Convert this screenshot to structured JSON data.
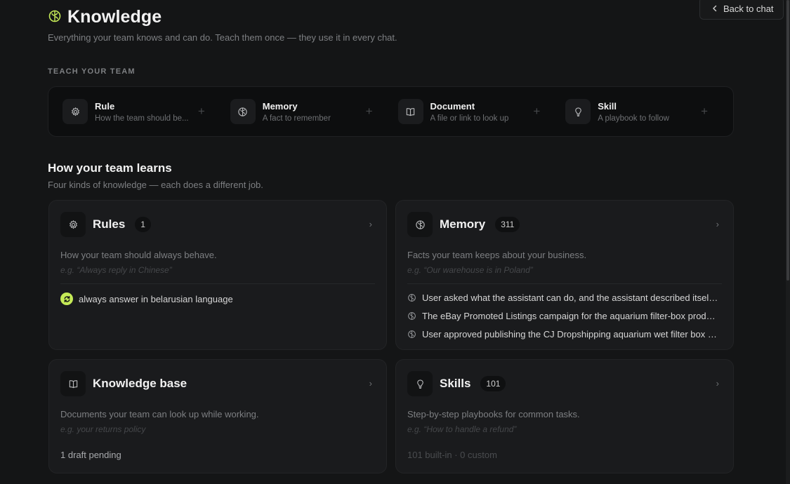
{
  "header": {
    "title": "Knowledge",
    "subtitle": "Everything your team knows and can do. Teach them once — they use it in every chat.",
    "back_label": "Back to chat"
  },
  "teach": {
    "label": "TEACH YOUR TEAM",
    "items": [
      {
        "name": "Rule",
        "desc": "How the team should be...",
        "icon": "gear-icon"
      },
      {
        "name": "Memory",
        "desc": "A fact to remember",
        "icon": "brain-icon"
      },
      {
        "name": "Document",
        "desc": "A file or link to look up",
        "icon": "book-icon"
      },
      {
        "name": "Skill",
        "desc": "A playbook to follow",
        "icon": "lightbulb-icon"
      }
    ],
    "plus": "+"
  },
  "learn": {
    "title": "How your team learns",
    "subtitle": "Four kinds of knowledge — each does a different job."
  },
  "cards": {
    "rules": {
      "title": "Rules",
      "count": "1",
      "desc": "How your team should always behave.",
      "example": "e.g. “Always reply in Chinese”",
      "item": "always answer in belarusian language"
    },
    "memory": {
      "title": "Memory",
      "count": "311",
      "desc": "Facts your team keeps about your business.",
      "example": "e.g. “Our warehouse is in Poland”",
      "items": [
        "User asked what the assistant can do, and the assistant described itself as a team of AI agents",
        "The eBay Promoted Listings campaign for the aquarium filter-box product was set up",
        "User approved publishing the CJ Dropshipping aquarium wet filter box listing"
      ]
    },
    "kb": {
      "title": "Knowledge base",
      "desc": "Documents your team can look up while working.",
      "example": "e.g. your returns policy",
      "footer": "1 draft pending"
    },
    "skills": {
      "title": "Skills",
      "count": "101",
      "desc": "Step-by-step playbooks for common tasks.",
      "example": "e.g. “How to handle a refund”",
      "footer": "101 built-in · 0 custom"
    }
  },
  "colors": {
    "background": "#141516",
    "card": "#1a1b1d",
    "accent": "#c5ea57",
    "muted": "#7d7f82"
  }
}
